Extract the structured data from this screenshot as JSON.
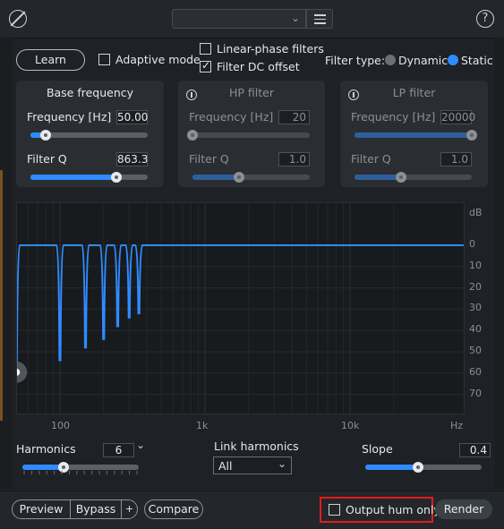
{
  "toolbar": {
    "help": "?"
  },
  "controls": {
    "learn": "Learn",
    "adaptive": "Adaptive mode",
    "linear_phase": "Linear-phase filters",
    "filter_dc": "Filter DC offset",
    "filter_type_label": "Filter type:",
    "dynamic": "Dynamic",
    "static": "Static",
    "filter_type_selected": "Static",
    "adaptive_checked": false,
    "linear_phase_checked": false,
    "filter_dc_checked": true
  },
  "base": {
    "title": "Base frequency",
    "freq_label": "Frequency [Hz]",
    "freq_value": "50.00",
    "freq_level": 0.13,
    "q_label": "Filter Q",
    "q_value": "863.3",
    "q_level": 0.73
  },
  "hp": {
    "title": "HP filter",
    "freq_label": "Frequency [Hz]",
    "freq_value": "20",
    "freq_level": 0.0,
    "q_label": "Filter Q",
    "q_value": "1.0",
    "q_level": 0.4,
    "enabled": false
  },
  "lp": {
    "title": "LP filter",
    "freq_label": "Frequency [Hz]",
    "freq_value": "20000",
    "freq_level": 1.0,
    "q_label": "Filter Q",
    "q_value": "1.0",
    "q_level": 0.4,
    "enabled": false
  },
  "graph": {
    "db_unit": "dB",
    "db_ticks": [
      "0",
      "10",
      "20",
      "30",
      "40",
      "50",
      "60",
      "70"
    ],
    "freq_ticks": [
      "100",
      "1k",
      "10k"
    ],
    "hz_unit": "Hz",
    "notch_freqs_hz": [
      50,
      100,
      150,
      200,
      250,
      300,
      350
    ],
    "notch_depth_db": [
      -60,
      -54,
      -48,
      -44,
      -38,
      -34,
      -32
    ]
  },
  "bottom": {
    "harmonics_label": "Harmonics",
    "harmonics_value": "6",
    "harmonics_level": 0.35,
    "link_label": "Link harmonics",
    "link_value": "All",
    "slope_label": "Slope",
    "slope_value": "0.4",
    "slope_level": 0.45
  },
  "footer": {
    "preview": "Preview",
    "bypass": "Bypass",
    "plus": "+",
    "compare": "Compare",
    "output_hum": "Output hum only",
    "render": "Render",
    "output_hum_checked": false
  },
  "colors": {
    "accent": "#2f8bff",
    "highlight": "#e31b1b"
  }
}
